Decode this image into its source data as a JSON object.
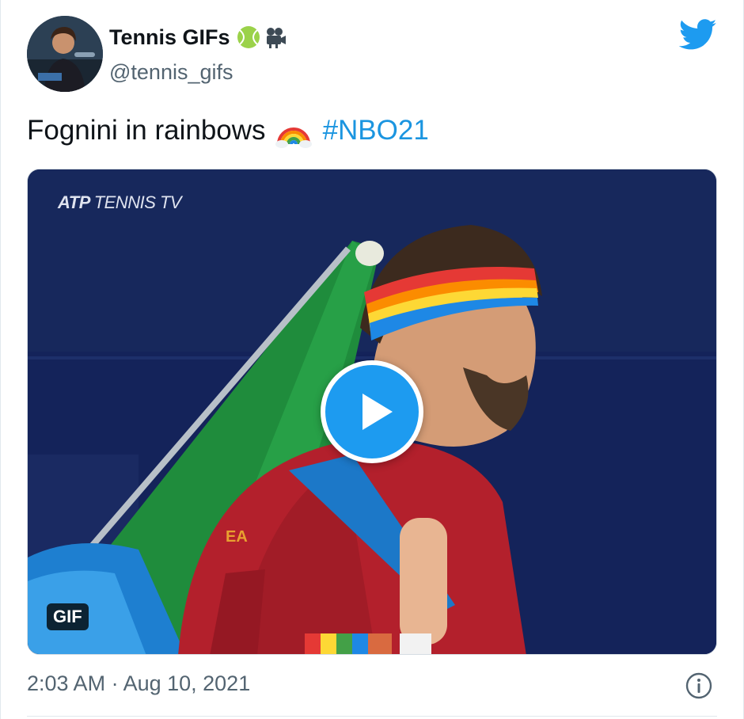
{
  "author": {
    "name": "Tennis GIFs",
    "handle": "@tennis_gifs",
    "name_emojis": [
      "tennis-ball-emoji",
      "movie-camera-emoji"
    ]
  },
  "tweet": {
    "text": "Fognini in rainbows",
    "emoji": "rainbow-emoji",
    "hashtag": "#NBO21"
  },
  "media": {
    "watermark_brand": "ATP",
    "watermark_label": "TENNIS TV",
    "badge": "GIF",
    "play_icon": "play-icon"
  },
  "footer": {
    "timestamp": "2:03 AM · Aug 10, 2021",
    "info_icon": "info-icon"
  },
  "colors": {
    "accent": "#1d9bf0",
    "hashtag": "#1b95e0",
    "muted_text": "#536471",
    "primary_text": "#0f1419"
  }
}
